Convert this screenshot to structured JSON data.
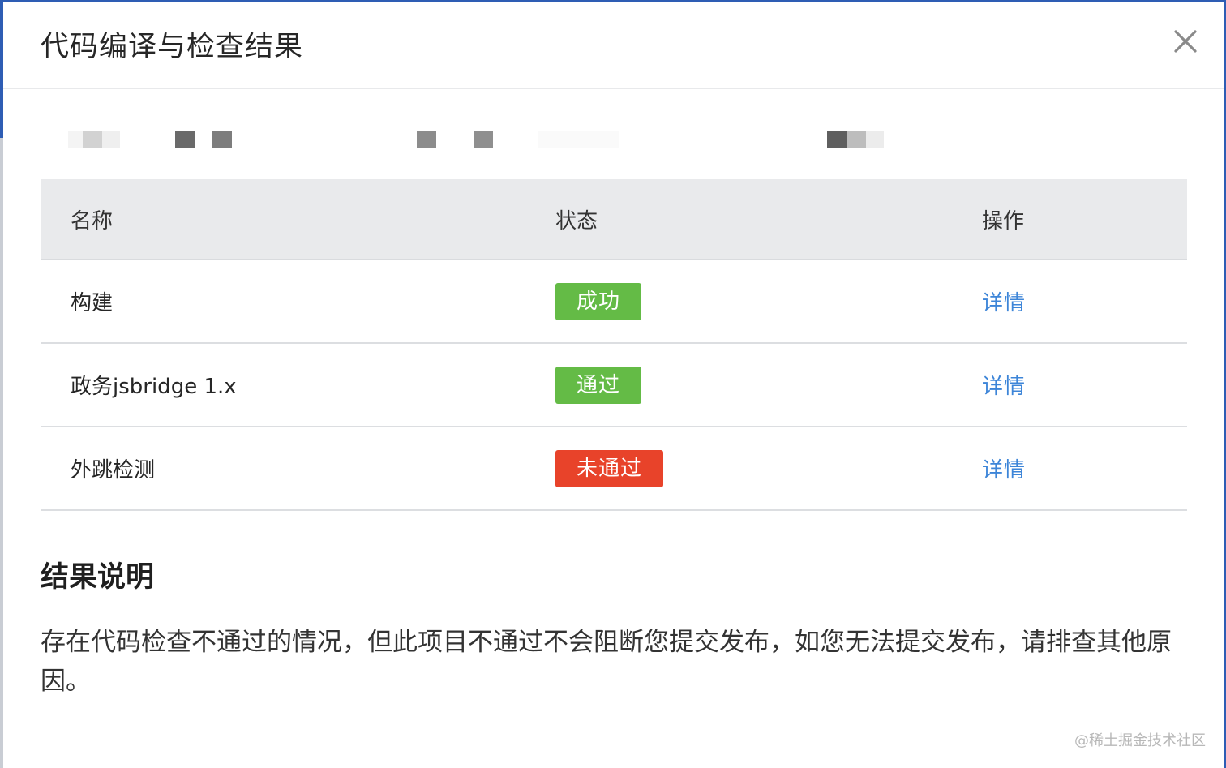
{
  "dialog": {
    "title": "代码编译与检查结果",
    "close_icon": "close-icon"
  },
  "table": {
    "headers": {
      "name": "名称",
      "status": "状态",
      "operation": "操作"
    },
    "rows": [
      {
        "name": "构建",
        "status": "成功",
        "status_color": "#64bb46",
        "action": "详情"
      },
      {
        "name": "政务jsbridge 1.x",
        "status": "通过",
        "status_color": "#64bb46",
        "action": "详情"
      },
      {
        "name": "外跳检测",
        "status": "未通过",
        "status_color": "#e8432a",
        "action": "详情"
      }
    ]
  },
  "explanation": {
    "title": "结果说明",
    "text": "存在代码检查不通过的情况，但此项目不通过不会阻断您提交发布，如您无法提交发布，请排查其他原因。"
  },
  "watermark": "@稀土掘金技术社区",
  "colors": {
    "link": "#3d85d8",
    "success": "#64bb46",
    "fail": "#e8432a",
    "table_header_bg": "#e9eaec"
  }
}
